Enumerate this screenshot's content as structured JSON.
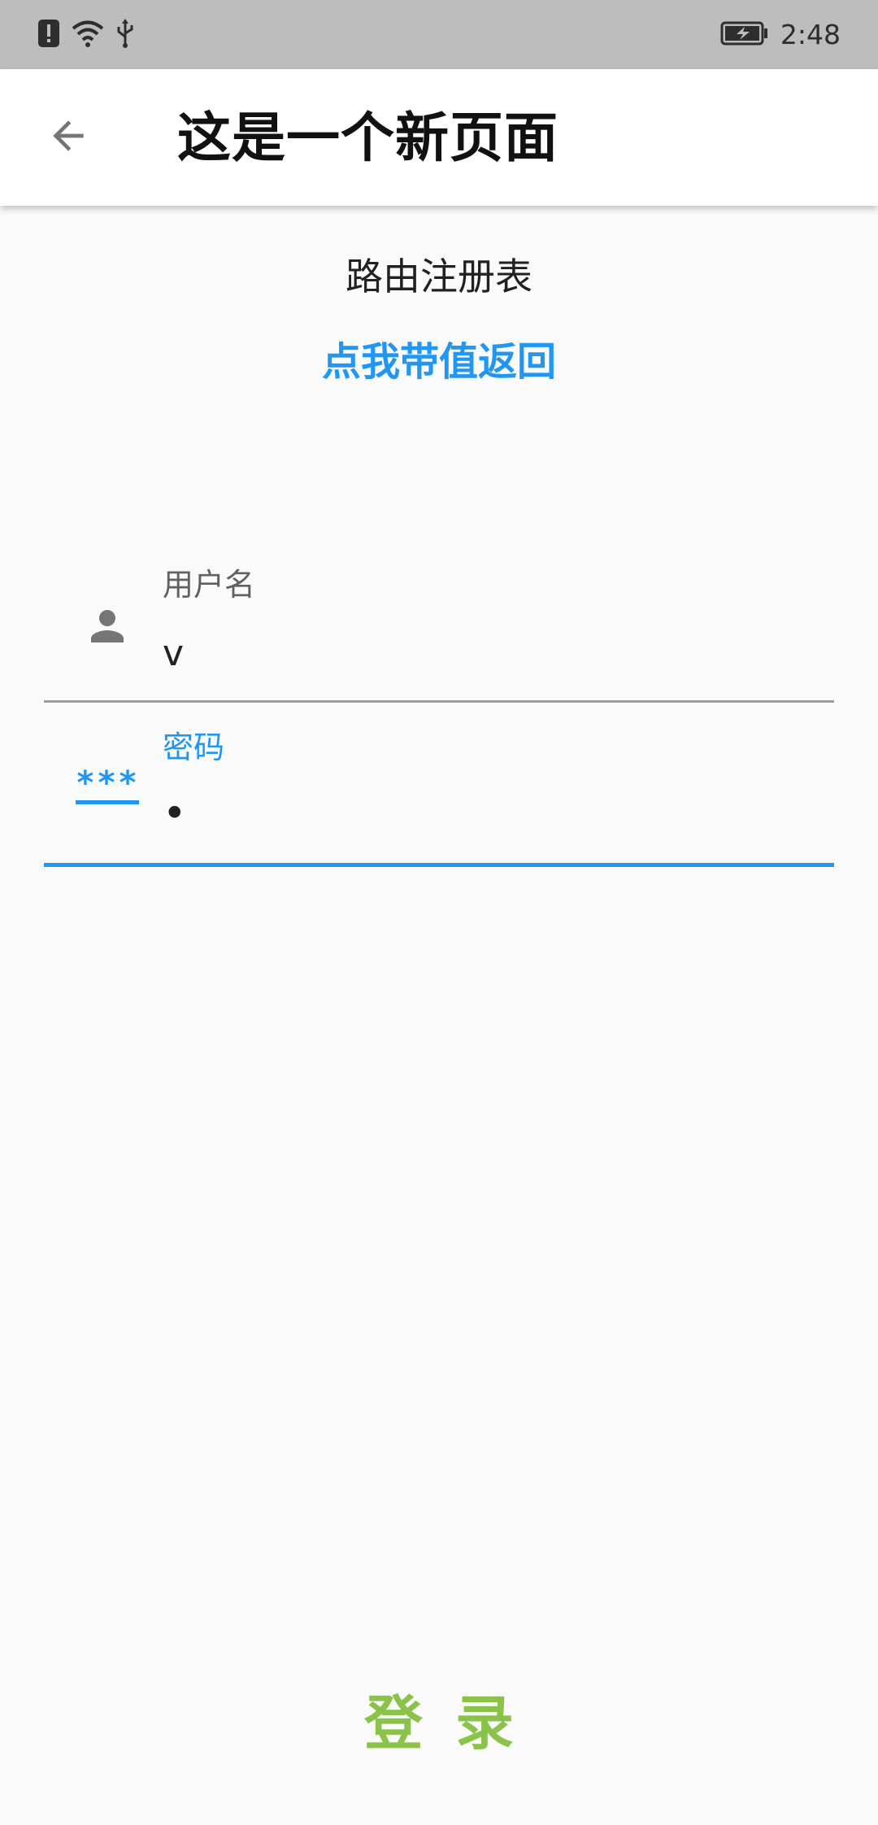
{
  "status_bar": {
    "time": "2:48",
    "icons": [
      "alert-icon",
      "wifi-icon",
      "usb-icon",
      "battery-charging-icon"
    ]
  },
  "app_bar": {
    "title": "这是一个新页面",
    "back_icon": "arrow-back-icon"
  },
  "content": {
    "route_title": "路由注册表",
    "return_link": "点我带值返回"
  },
  "form": {
    "username": {
      "label": "用户名",
      "value": "v",
      "icon": "person-icon"
    },
    "password": {
      "label": "密码",
      "value": "•",
      "icon_text": "***"
    },
    "login_label": "登录"
  },
  "colors": {
    "primary": "#2196f3",
    "login": "#8bc34a",
    "status_bar": "#bdbdbd",
    "background": "#fafafa"
  }
}
